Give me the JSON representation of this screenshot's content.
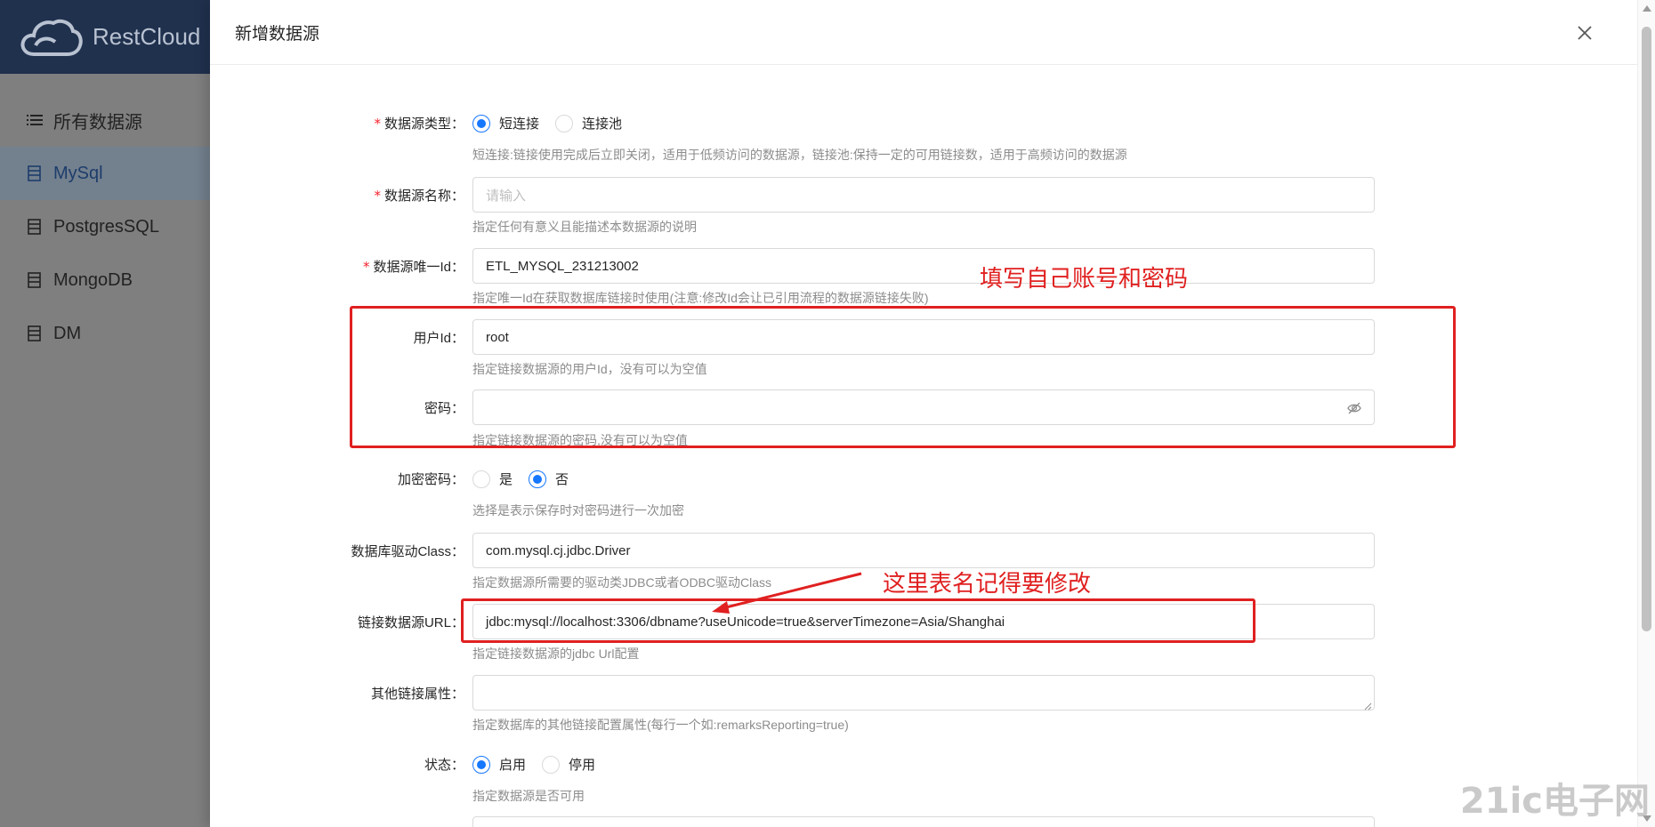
{
  "app": {
    "name": "RestCloud"
  },
  "sidebar": {
    "items": [
      {
        "label": "所有数据源",
        "active": false
      },
      {
        "label": "MySql",
        "active": true
      },
      {
        "label": "PostgresSQL",
        "active": false
      },
      {
        "label": "MongoDB",
        "active": false
      },
      {
        "label": "DM",
        "active": false
      }
    ]
  },
  "drawer": {
    "title": "新增数据源"
  },
  "form": {
    "type": {
      "label": "数据源类型",
      "options": [
        "短连接",
        "连接池"
      ],
      "selected": "短连接",
      "help": "短连接:链接使用完成后立即关闭，适用于低频访问的数据源，链接池:保持一定的可用链接数，适用于高频访问的数据源"
    },
    "name": {
      "label": "数据源名称",
      "placeholder": "请输入",
      "value": "",
      "help": "指定任何有意义且能描述本数据源的说明"
    },
    "uid": {
      "label": "数据源唯一Id",
      "value": "ETL_MYSQL_231213002",
      "help": "指定唯一Id在获取数据库链接时使用(注意:修改Id会让已引用流程的数据源链接失败)"
    },
    "user": {
      "label": "用户Id",
      "value": "root",
      "help": "指定链接数据源的用户Id，没有可以为空值"
    },
    "password": {
      "label": "密码",
      "value": "",
      "help": "指定链接数据源的密码,没有可以为空值"
    },
    "encrypt": {
      "label": "加密密码",
      "options": [
        "是",
        "否"
      ],
      "selected": "否",
      "help": "选择是表示保存时对密码进行一次加密"
    },
    "driver": {
      "label": "数据库驱动Class",
      "value": "com.mysql.cj.jdbc.Driver",
      "help": "指定数据源所需要的驱动类JDBC或者ODBC驱动Class"
    },
    "url": {
      "label": "链接数据源URL",
      "value": "jdbc:mysql://localhost:3306/dbname?useUnicode=true&serverTimezone=Asia/Shanghai",
      "help": "指定链接数据源的jdbc Url配置"
    },
    "props": {
      "label": "其他链接属性",
      "value": "",
      "help": "指定数据库的其他链接配置属性(每行一个如:remarksReporting=true)"
    },
    "status": {
      "label": "状态",
      "options": [
        "启用",
        "停用"
      ],
      "selected": "启用",
      "help": "指定数据源是否可用"
    }
  },
  "annotations": {
    "account_note": "填写自己账号和密码",
    "url_note": "这里表名记得要修改"
  },
  "watermark": "21ic电子网",
  "colors": {
    "primary": "#1677ff",
    "annotation": "#e02020",
    "sidebar_header": "#20314e"
  }
}
